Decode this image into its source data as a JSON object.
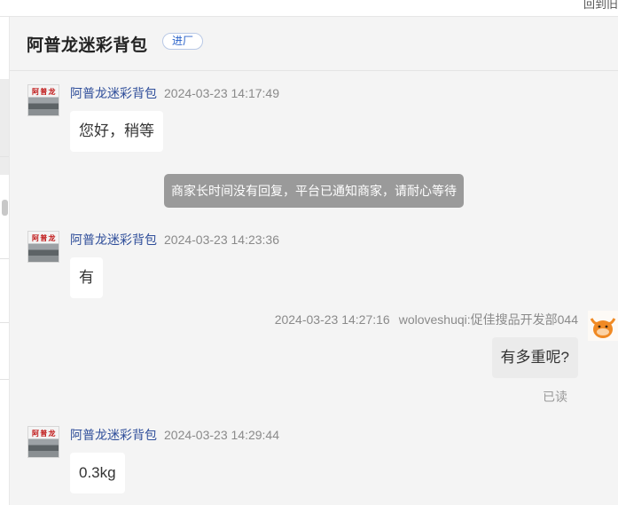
{
  "top_bar": {
    "link": "回到旧"
  },
  "header": {
    "title": "阿普龙迷彩背包",
    "enter_button": "进厂"
  },
  "avatar_logo_text": "阿 普 龙",
  "messages": [
    {
      "from": "shop",
      "sender": "阿普龙迷彩背包",
      "time": "2024-03-23 14:17:49",
      "text": "您好，稍等"
    },
    {
      "from": "system",
      "text": "商家长时间没有回复，平台已通知商家，请耐心等待"
    },
    {
      "from": "shop",
      "sender": "阿普龙迷彩背包",
      "time": "2024-03-23 14:23:36",
      "text": "有"
    },
    {
      "from": "me",
      "sender": "woloveshuqi:促佳搜品开发部044",
      "time": "2024-03-23 14:27:16",
      "text": "有多重呢?",
      "status": "已读"
    },
    {
      "from": "shop",
      "sender": "阿普龙迷彩背包",
      "time": "2024-03-23 14:29:44",
      "text": "0.3kg"
    }
  ],
  "colors": {
    "chat_background": "#f4f4f4",
    "sender_name": "#2f4e9a",
    "timestamp": "#8a8a8a",
    "system_notice_bg": "#9a9a9a",
    "enter_button_text": "#2a62c9"
  }
}
